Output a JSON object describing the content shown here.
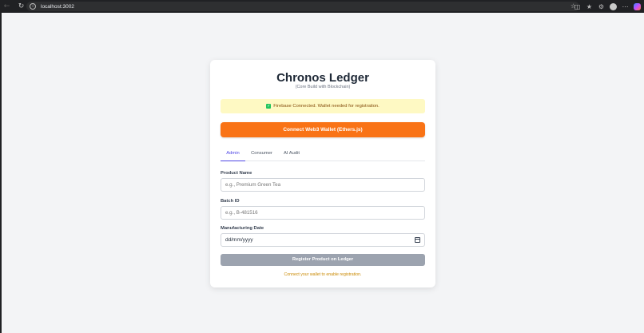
{
  "browser": {
    "url": "localhost:3002"
  },
  "app": {
    "title": "Chronos Ledger",
    "subtitle": "(Core Build with Blockchain)",
    "status": "Firebase Connected. Wallet needed for registration.",
    "connect_button": "Connect Web3 Wallet (Ethers.js)",
    "tabs": [
      {
        "label": "Admin",
        "active": true
      },
      {
        "label": "Consumer",
        "active": false
      },
      {
        "label": "AI Audit",
        "active": false
      }
    ],
    "form": {
      "product_name": {
        "label": "Product Name",
        "placeholder": "e.g., Premium Green Tea",
        "value": ""
      },
      "batch_id": {
        "label": "Batch ID",
        "placeholder": "e.g., B-481516",
        "value": ""
      },
      "manufacturing_date": {
        "label": "Manufacturing Date",
        "value": "dd/mm/yyyy"
      }
    },
    "register_button": "Register Product on Ledger",
    "hint": "Connect your wallet to enable registration."
  },
  "colors": {
    "accent": "#4f46e5",
    "connect_button": "#f97316",
    "status_banner": "#fef9c3",
    "disabled_button": "#9ca3af",
    "hint": "#ca8a04"
  }
}
